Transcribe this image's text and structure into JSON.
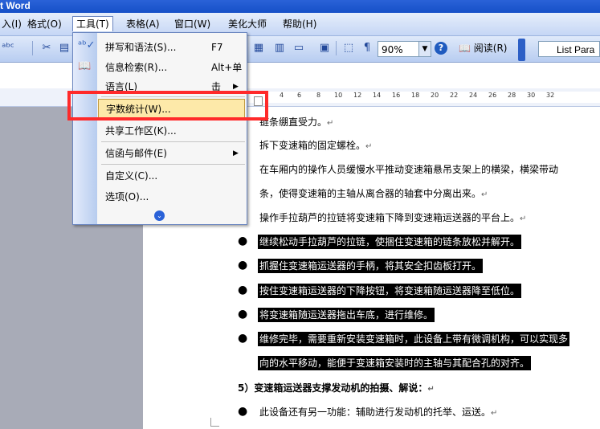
{
  "window": {
    "title": "t Word"
  },
  "menubar": {
    "items": [
      {
        "label": "入(I)"
      },
      {
        "label": "格式(O)"
      },
      {
        "label": "工具(T)"
      },
      {
        "label": "表格(A)"
      },
      {
        "label": "窗口(W)"
      },
      {
        "label": "美化大师"
      },
      {
        "label": "帮助(H)"
      }
    ]
  },
  "toolbar": {
    "zoom": "90%",
    "read_label": "阅读(R)",
    "style_value": "List Para",
    "icons": [
      "spellcheck-icon",
      "cut-icon",
      "paste-icon",
      "table-icon",
      "columns-icon",
      "drawing-icon",
      "doc-map-icon",
      "para-mark-icon",
      "zoom-icon",
      "help-icon",
      "read-icon",
      "style-icon"
    ]
  },
  "ruler": {
    "ticks": [
      "4",
      "6",
      "8",
      "10",
      "12",
      "14",
      "16",
      "18",
      "20",
      "22",
      "24",
      "26",
      "28",
      "30",
      "32"
    ]
  },
  "tools_menu": {
    "items": [
      {
        "label": "拼写和语法(S)...",
        "shortcut": "F7",
        "icon": "spellcheck-icon"
      },
      {
        "label": "信息检索(R)...",
        "shortcut": "Alt+单击",
        "icon": "research-icon"
      },
      {
        "label": "语言(L)",
        "submenu": true
      },
      {
        "label": "字数统计(W)...",
        "highlighted": true
      },
      {
        "label": "共享工作区(K)..."
      },
      {
        "label": "信函与邮件(E)",
        "submenu": true
      },
      {
        "label": "自定义(C)..."
      },
      {
        "label": "选项(O)..."
      }
    ],
    "more": "expand-more-icon"
  },
  "document": {
    "lines": [
      "链条绷直受力。",
      "拆下变速箱的固定螺栓。",
      "在车厢内的操作人员缓慢水平推动变速箱悬吊支架上的横梁，横梁带动",
      "条，使得变速箱的主轴从离合器的轴套中分离出来。",
      "操作手拉葫芦的拉链将变速箱下降到变速箱运送器的平台上。"
    ],
    "bullets": [
      "继续松动手拉葫芦的拉链，使捆住变速箱的链条放松并解开。",
      "抓握住变速箱运送器的手柄，将其安全扣齿板打开。",
      "按住变速箱运送器的下降按钮，将变速箱随运送器降至低位。",
      "将变速箱随运送器拖出车底，进行维修。",
      "维修完毕，需要重新安装变速箱时，此设备上带有微调机构，可以实现多"
    ],
    "bullet5_cont": "向的水平移动，能便于变速箱安装时的主轴与其配合孔的对齐。",
    "heading": "5）变速箱运送器支撑发动机的拍摄、解说：",
    "last_bullet": "此设备还有另一功能：辅助进行发动机的托举、运送。"
  },
  "colors": {
    "highlight_box": "#ff2a2a",
    "menu_hover": "#fde9a9",
    "selection": "#000000"
  }
}
